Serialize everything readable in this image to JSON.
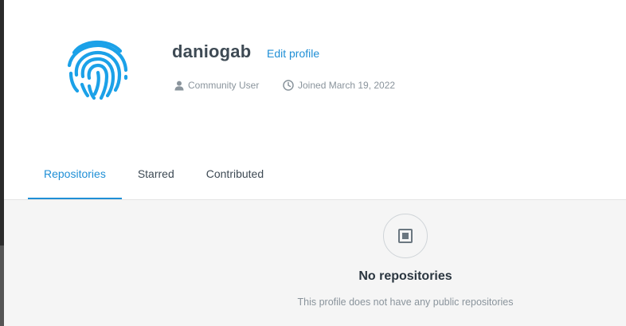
{
  "profile": {
    "username": "daniogab",
    "edit_label": "Edit profile",
    "role": "Community User",
    "joined": "Joined March 19, 2022",
    "avatar_icon": "fingerprint-icon",
    "accent_color": "#1f8fd6"
  },
  "tabs": [
    {
      "label": "Repositories",
      "active": true
    },
    {
      "label": "Starred",
      "active": false
    },
    {
      "label": "Contributed",
      "active": false
    }
  ],
  "empty_state": {
    "icon": "repository-icon",
    "title": "No repositories",
    "subtitle": "This profile does not have any public repositories"
  }
}
